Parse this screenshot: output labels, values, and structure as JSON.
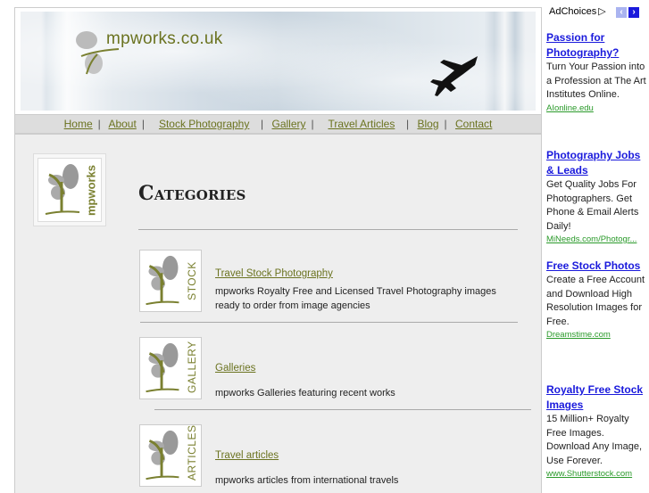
{
  "header": {
    "site_name": "mpworks.co.uk"
  },
  "nav": {
    "items": [
      "Home",
      "About",
      "Stock Photography",
      "Gallery",
      "Travel Articles",
      "Blog",
      "Contact"
    ]
  },
  "side_logo": {
    "text": "mpworks"
  },
  "main": {
    "title": "Categories",
    "categories": [
      {
        "badge": "STOCK",
        "link": "Travel Stock Photography",
        "desc": "mpworks Royalty Free and Licensed Travel Photography images ready to order from image agencies"
      },
      {
        "badge": "GALLERY",
        "link": "Galleries",
        "desc": "mpworks Galleries featuring recent works"
      },
      {
        "badge": "ARTICLES",
        "link": "Travel articles",
        "desc": "mpworks articles from international travels"
      }
    ]
  },
  "ads": {
    "adchoices": "AdChoices",
    "items": [
      {
        "title": "Passion for Photography?",
        "desc": "Turn Your Passion into a Profession at The Art Institutes Online.",
        "url": "AIonline.edu"
      },
      {
        "title": "Photography Jobs & Leads",
        "desc": "Get Quality Jobs For Photographers. Get Phone & Email Alerts Daily!",
        "url": "MiNeeds.com/Photogr..."
      },
      {
        "title": "Free Stock Photos",
        "desc": "Create a Free Account and Download High Resolution Images for Free.",
        "url": "Dreamstime.com"
      },
      {
        "title": "Royalty Free Stock Images",
        "desc": "15 Million+ Royalty Free Images. Download Any Image, Use Forever.",
        "url": "www.Shutterstock.com"
      }
    ]
  },
  "colors": {
    "accent": "#6b7320",
    "ad_link": "#1a1adc",
    "ad_url": "#2a9a2a"
  }
}
